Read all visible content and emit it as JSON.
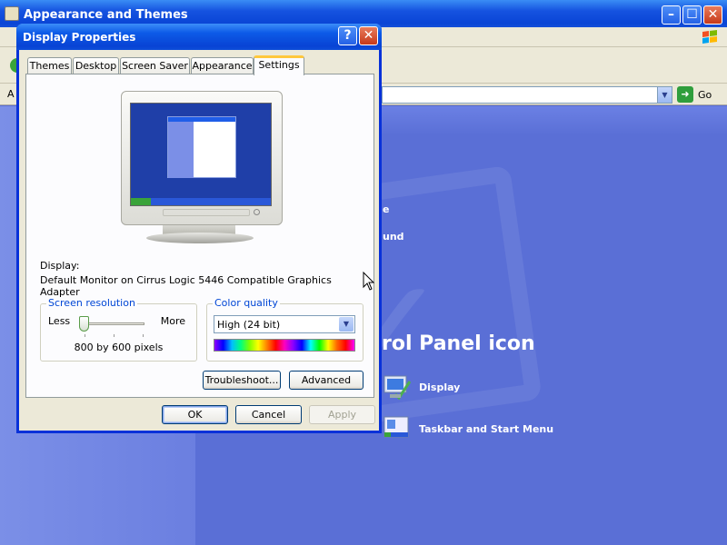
{
  "background_window": {
    "title": "Appearance and Themes",
    "address_label": "A",
    "go_label": "Go",
    "pick_task_lines": [
      "e",
      "und"
    ],
    "heading": "rol Panel icon",
    "icons": [
      {
        "label": "Display",
        "icon": "display-icon"
      },
      {
        "label": "Taskbar and Start Menu",
        "icon": "taskbar-icon"
      }
    ]
  },
  "dialog": {
    "title": "Display Properties",
    "help_glyph": "?",
    "close_glyph": "✕",
    "tabs": [
      "Themes",
      "Desktop",
      "Screen Saver",
      "Appearance",
      "Settings"
    ],
    "active_tab": "Settings",
    "display_label": "Display:",
    "adapter": "Default Monitor on Cirrus Logic 5446 Compatible Graphics Adapter",
    "screen_resolution": {
      "group_title": "Screen resolution",
      "less_label": "Less",
      "more_label": "More",
      "value_text": "800 by 600 pixels",
      "slider_fraction": 0.0
    },
    "color_quality": {
      "group_title": "Color quality",
      "selected": "High (24 bit)"
    },
    "buttons": {
      "troubleshoot": "Troubleshoot...",
      "advanced": "Advanced",
      "ok": "OK",
      "cancel": "Cancel",
      "apply": "Apply"
    }
  },
  "colors": {
    "titlebar_blue": "#0843d4",
    "desktop_blue": "#5a6fd6",
    "group_title_blue": "#0046d5",
    "tab_highlight": "#ffc83c"
  }
}
